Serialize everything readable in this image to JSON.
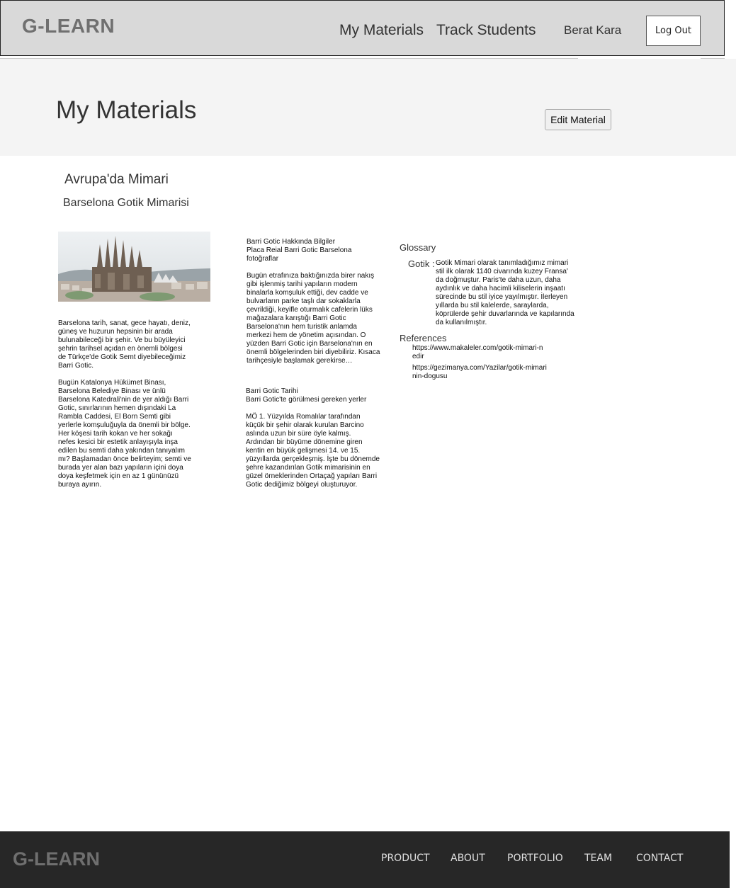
{
  "nav": {
    "logo": "G-LEARN",
    "links": [
      "My Materials",
      "Track Students"
    ],
    "user_name": "Berat Kara",
    "logout_label": "Log Out"
  },
  "header": {
    "page_title": "My Materials",
    "edit_button_label": "Edit Material"
  },
  "material": {
    "course_title": "Avrupa'da Mimari",
    "title": "Barselona Gotik Mimarisi",
    "image_icon": "sagrada-familia-photo",
    "column1": {
      "paragraph1": "Barselona tarih, sanat, gece hayatı, deniz,\ngüneş ve huzurun hepsinin bir arada\nbulunabileceği bir şehir. Ve bu büyüleyici\nşehrin tarihsel açıdan en önemli bölgesi\nde Türkçe'de Gotik Semt diyebileceğimiz\nBarri Gotic.",
      "paragraph2": "Bugün Katalonya Hükümet Binası,\nBarselona Belediye Binası ve ünlü\nBarselona Katedrali'nin de yer aldığı Barri\nGotic, sınırlarının hemen dışındaki La\nRambla Caddesi, El Born Semti gibi\nyerlerle komşuluğuyla da önemli bir bölge.\nHer köşesi tarih kokan ve her sokağı\nnefes kesici bir estetik anlayışıyla inşa\nedilen bu semti daha yakından tanıyalım\nmı? Başlamadan önce belirteyim; semti ve\nburada yer alan bazı yapıların içini doya\ndoya keşfetmek için en az 1 gününüzü\nburaya ayırın."
    },
    "column2": {
      "section1": "Barri Gotic Hakkında Bilgiler\nPlaca Reial Barri Gotic Barselona\nfotoğraflar\n\nBugün etrafınıza baktığınızda birer nakış\ngibi işlenmiş tarihi yapıların modern\nbinalarla komşuluk ettiği, dev cadde ve\nbulvarların parke taşlı dar sokaklarla\nçevrildiği, keyifle oturmalık cafelerin lüks\nmağazalara karıştığı Barri Gotic\nBarselona'nın hem turistik anlamda\nmerkezi hem de yönetim açısından. O\nyüzden Barri Gotic için Barselona'nın en\nönemli bölgelerinden biri diyebiliriz. Kısaca\ntarihçesiyle başlamak gerekirse…",
      "section2": "Barri Gotic Tarihi\nBarri Gotic'te görülmesi gereken yerler\n\nMÖ 1. Yüzyılda Romalılar tarafından\nküçük bir şehir olarak kurulan Barcino\naslında uzun bir süre öyle kalmış.\nArdından bir büyüme dönemine giren\nkentin en büyük gelişmesi 14. ve 15.\nyüzyıllarda gerçekleşmiş. İşte bu dönemde\nşehre kazandırılan Gotik mimarisinin en\ngüzel örneklerinden Ortaçağ yapıları Barri\nGotic dediğimiz bölgeyi oluşturuyor."
    },
    "glossary": {
      "heading": "Glossary",
      "term": "Gotik :",
      "definition": "Gotik Mimari olarak tanımladığımız mimari stil ilk olarak 1140 civarında kuzey Fransa' da doğmuştur. Paris'te daha uzun, daha aydınlık ve daha hacimli kiliselerin inşaatı sürecinde bu stil iyice yayılmıştır. İlerleyen yıllarda bu stil kalelerde, saraylarda, köprülerde şehir duvarlarında ve kapılarında da kullanılmıştır."
    },
    "references": {
      "heading": "References",
      "items": [
        "https://www.makaleler.com/gotik-mimari-nedir",
        "https://gezimanya.com/Yazilar/gotik-mimarinin-dogusu"
      ]
    }
  },
  "footer": {
    "logo": "G-LEARN",
    "links": [
      "PRODUCT",
      "ABOUT",
      "PORTFOLIO",
      "TEAM",
      "CONTACT"
    ]
  }
}
